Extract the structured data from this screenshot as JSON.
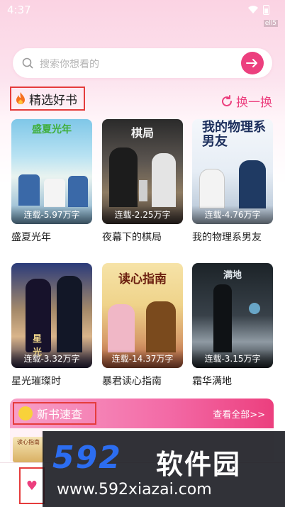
{
  "status": {
    "time": "4:37",
    "tag": "ell5"
  },
  "search": {
    "placeholder": "搜索你想看的"
  },
  "featured": {
    "title": "精选好书",
    "refresh_label": "换一换",
    "books": [
      {
        "title": "盛夏光年",
        "meta": "连载-5.97万字",
        "cover_text": "盛夏光年"
      },
      {
        "title": "夜幕下的棋局",
        "meta": "连载-2.25万字",
        "cover_text": "棋局"
      },
      {
        "title": "我的物理系男友",
        "meta": "连载-4.76万字",
        "cover_text": "我的物理系男友"
      },
      {
        "title": "星光璀璨时",
        "meta": "连载-3.32万字",
        "cover_text": "星光"
      },
      {
        "title": "暴君读心指南",
        "meta": "连载-14.37万字",
        "cover_text": "读心指南"
      },
      {
        "title": "霜华满地",
        "meta": "连载-3.15万字",
        "cover_text": "满地"
      }
    ]
  },
  "new_books": {
    "title": "新书速查",
    "see_all": "查看全部>>",
    "mini_cover_text": "读心指南"
  },
  "watermark": {
    "logo": "592",
    "logo_cn": "软件园",
    "url": "www.592xiazai.com"
  },
  "colors": {
    "accent": "#ec3f7e",
    "highlight_border": "#e53c3c"
  }
}
